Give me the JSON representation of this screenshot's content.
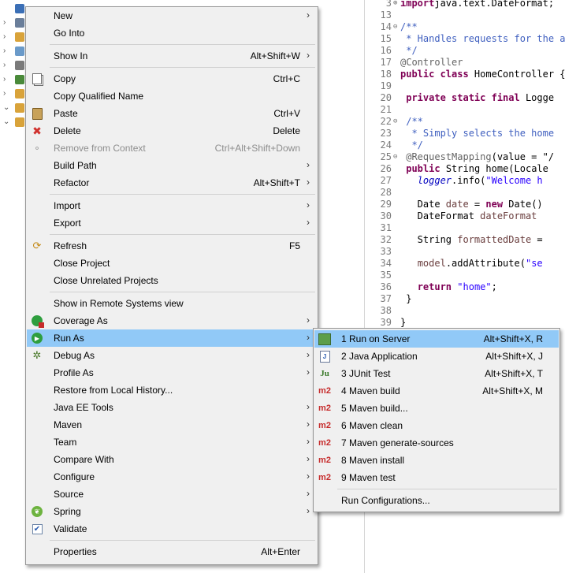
{
  "explorer": {
    "rows": [
      {
        "twisty": "",
        "color": "#3b6fb6"
      },
      {
        "twisty": "›",
        "color": "#6a7e9a"
      },
      {
        "twisty": "›",
        "color": "#d9a33a"
      },
      {
        "twisty": "›",
        "color": "#6a9ac9"
      },
      {
        "twisty": "›",
        "color": "#7a7a7a"
      },
      {
        "twisty": "›",
        "color": "#4a8a3a"
      },
      {
        "twisty": "›",
        "color": "#d9a33a"
      },
      {
        "twisty": "⌄",
        "color": "#d9a33a"
      },
      {
        "twisty": "⌄",
        "color": "#d9a33a"
      }
    ]
  },
  "editor": {
    "lines": [
      {
        "n": "3",
        "fold": "⊕",
        "html_key": "l3"
      },
      {
        "n": "13",
        "fold": "",
        "html_key": "l13"
      },
      {
        "n": "14",
        "fold": "⊖",
        "html_key": "l14"
      },
      {
        "n": "15",
        "fold": "",
        "html_key": "l15"
      },
      {
        "n": "16",
        "fold": "",
        "html_key": "l16"
      },
      {
        "n": "17",
        "fold": "",
        "html_key": "l17"
      },
      {
        "n": "18",
        "fold": "",
        "html_key": "l18"
      },
      {
        "n": "19",
        "fold": "",
        "html_key": "l19"
      },
      {
        "n": "20",
        "fold": "",
        "html_key": "l20"
      },
      {
        "n": "21",
        "fold": "",
        "html_key": "l21"
      },
      {
        "n": "22",
        "fold": "⊖",
        "html_key": "l22"
      },
      {
        "n": "23",
        "fold": "",
        "html_key": "l23"
      },
      {
        "n": "24",
        "fold": "",
        "html_key": "l24"
      },
      {
        "n": "25",
        "fold": "⊖",
        "html_key": "l25"
      },
      {
        "n": "26",
        "fold": "",
        "html_key": "l26"
      },
      {
        "n": "27",
        "fold": "",
        "html_key": "l27"
      },
      {
        "n": "28",
        "fold": "",
        "html_key": "l28"
      },
      {
        "n": "29",
        "fold": "",
        "html_key": "l29"
      },
      {
        "n": "30",
        "fold": "",
        "html_key": "l30"
      },
      {
        "n": "31",
        "fold": "",
        "html_key": "l31"
      },
      {
        "n": "32",
        "fold": "",
        "html_key": "l32"
      },
      {
        "n": "33",
        "fold": "",
        "html_key": "l33"
      },
      {
        "n": "34",
        "fold": "",
        "html_key": "l34"
      },
      {
        "n": "35",
        "fold": "",
        "html_key": "l35"
      },
      {
        "n": "36",
        "fold": "",
        "html_key": "l36"
      },
      {
        "n": "37",
        "fold": "",
        "html_key": "l37"
      },
      {
        "n": "38",
        "fold": "",
        "html_key": "l38"
      },
      {
        "n": "39",
        "fold": "",
        "html_key": "l39"
      }
    ],
    "tokens": {
      "l3": [
        [
          "kw",
          "import"
        ],
        [
          "",
          "java.text.DateFormat;"
        ]
      ],
      "l13": [],
      "l14": [
        [
          "cm",
          "/**"
        ]
      ],
      "l15": [
        [
          "cm",
          " * Handles requests for the ap"
        ]
      ],
      "l16": [
        [
          "cm",
          " */"
        ]
      ],
      "l17": [
        [
          "an",
          "@Controller"
        ]
      ],
      "l18": [
        [
          "kw",
          "public class"
        ],
        [
          "",
          " HomeController {"
        ]
      ],
      "l19": [],
      "l20": [
        [
          "",
          " "
        ],
        [
          "kw",
          "private static final"
        ],
        [
          "",
          " Logge"
        ]
      ],
      "l21": [],
      "l22": [
        [
          "",
          " "
        ],
        [
          "cm",
          "/**"
        ]
      ],
      "l23": [
        [
          "cm",
          "  * Simply selects the home"
        ]
      ],
      "l24": [
        [
          "cm",
          "  */"
        ]
      ],
      "l25": [
        [
          "",
          " "
        ],
        [
          "an",
          "@RequestMapping"
        ],
        [
          "",
          "(value = \"/"
        ]
      ],
      "l26": [
        [
          "",
          " "
        ],
        [
          "kw",
          "public"
        ],
        [
          "",
          " String home(Locale"
        ]
      ],
      "l27": [
        [
          "",
          "   "
        ],
        [
          "it",
          "logger"
        ],
        [
          "",
          ".info("
        ],
        [
          "st",
          "\"Welcome h"
        ]
      ],
      "l28": [],
      "l29": [
        [
          "",
          "   Date "
        ],
        [
          "lv",
          "date"
        ],
        [
          "",
          " = "
        ],
        [
          "kw",
          "new"
        ],
        [
          "",
          " Date()"
        ]
      ],
      "l30": [
        [
          "",
          "   DateFormat "
        ],
        [
          "lv",
          "dateFormat"
        ]
      ],
      "l31": [],
      "l32": [
        [
          "",
          "   String "
        ],
        [
          "lv",
          "formattedDate"
        ],
        [
          "",
          " ="
        ]
      ],
      "l33": [],
      "l34": [
        [
          "",
          "   "
        ],
        [
          "lv",
          "model"
        ],
        [
          "",
          ".addAttribute("
        ],
        [
          "st",
          "\"se"
        ]
      ],
      "l35": [],
      "l36": [
        [
          "",
          "   "
        ],
        [
          "kw",
          "return"
        ],
        [
          "",
          " "
        ],
        [
          "st",
          "\"home\""
        ],
        [
          "",
          ";"
        ]
      ],
      "l37": [
        [
          "",
          " }"
        ]
      ],
      "l38": [],
      "l39": [
        [
          "",
          "}"
        ]
      ]
    }
  },
  "main_menu": {
    "items": [
      {
        "label": "New",
        "shortcut": "",
        "submenu": true,
        "icon": "",
        "disabled": false
      },
      {
        "label": "Go Into",
        "shortcut": "",
        "submenu": false,
        "icon": "",
        "disabled": false
      },
      {
        "sep": true
      },
      {
        "label": "Show In",
        "shortcut": "Alt+Shift+W",
        "submenu": true,
        "icon": "",
        "disabled": false
      },
      {
        "sep": true
      },
      {
        "label": "Copy",
        "shortcut": "Ctrl+C",
        "submenu": false,
        "icon": "copy-icon",
        "disabled": false
      },
      {
        "label": "Copy Qualified Name",
        "shortcut": "",
        "submenu": false,
        "icon": "",
        "disabled": false
      },
      {
        "label": "Paste",
        "shortcut": "Ctrl+V",
        "submenu": false,
        "icon": "paste-icon",
        "disabled": false
      },
      {
        "label": "Delete",
        "shortcut": "Delete",
        "submenu": false,
        "icon": "delete-icon",
        "disabled": false
      },
      {
        "label": "Remove from Context",
        "shortcut": "Ctrl+Alt+Shift+Down",
        "submenu": false,
        "icon": "remove-context-icon",
        "disabled": true
      },
      {
        "label": "Build Path",
        "shortcut": "",
        "submenu": true,
        "icon": "",
        "disabled": false
      },
      {
        "label": "Refactor",
        "shortcut": "Alt+Shift+T",
        "submenu": true,
        "icon": "",
        "disabled": false
      },
      {
        "sep": true
      },
      {
        "label": "Import",
        "shortcut": "",
        "submenu": true,
        "icon": "",
        "disabled": false
      },
      {
        "label": "Export",
        "shortcut": "",
        "submenu": true,
        "icon": "",
        "disabled": false
      },
      {
        "sep": true
      },
      {
        "label": "Refresh",
        "shortcut": "F5",
        "submenu": false,
        "icon": "refresh-icon",
        "disabled": false
      },
      {
        "label": "Close Project",
        "shortcut": "",
        "submenu": false,
        "icon": "",
        "disabled": false
      },
      {
        "label": "Close Unrelated Projects",
        "shortcut": "",
        "submenu": false,
        "icon": "",
        "disabled": false
      },
      {
        "sep": true
      },
      {
        "label": "Show in Remote Systems view",
        "shortcut": "",
        "submenu": false,
        "icon": "",
        "disabled": false
      },
      {
        "label": "Coverage As",
        "shortcut": "",
        "submenu": true,
        "icon": "coverage-icon",
        "disabled": false
      },
      {
        "label": "Run As",
        "shortcut": "",
        "submenu": true,
        "icon": "run-icon",
        "disabled": false,
        "highlight": true
      },
      {
        "label": "Debug As",
        "shortcut": "",
        "submenu": true,
        "icon": "debug-icon",
        "disabled": false
      },
      {
        "label": "Profile As",
        "shortcut": "",
        "submenu": true,
        "icon": "",
        "disabled": false
      },
      {
        "label": "Restore from Local History...",
        "shortcut": "",
        "submenu": false,
        "icon": "",
        "disabled": false
      },
      {
        "label": "Java EE Tools",
        "shortcut": "",
        "submenu": true,
        "icon": "",
        "disabled": false
      },
      {
        "label": "Maven",
        "shortcut": "",
        "submenu": true,
        "icon": "",
        "disabled": false
      },
      {
        "label": "Team",
        "shortcut": "",
        "submenu": true,
        "icon": "",
        "disabled": false
      },
      {
        "label": "Compare With",
        "shortcut": "",
        "submenu": true,
        "icon": "",
        "disabled": false
      },
      {
        "label": "Configure",
        "shortcut": "",
        "submenu": true,
        "icon": "",
        "disabled": false
      },
      {
        "label": "Source",
        "shortcut": "",
        "submenu": true,
        "icon": "",
        "disabled": false
      },
      {
        "label": "Spring",
        "shortcut": "",
        "submenu": true,
        "icon": "spring-icon",
        "disabled": false
      },
      {
        "label": "Validate",
        "shortcut": "",
        "submenu": false,
        "icon": "check-icon",
        "disabled": false
      },
      {
        "sep": true
      },
      {
        "label": "Properties",
        "shortcut": "Alt+Enter",
        "submenu": false,
        "icon": "",
        "disabled": false
      }
    ]
  },
  "run_as_menu": {
    "items": [
      {
        "label": "1 Run on Server",
        "shortcut": "Alt+Shift+X, R",
        "icon": "server-icon",
        "highlight": true
      },
      {
        "label": "2 Java Application",
        "shortcut": "Alt+Shift+X, J",
        "icon": "java-app-icon"
      },
      {
        "label": "3 JUnit Test",
        "shortcut": "Alt+Shift+X, T",
        "icon": "junit-icon"
      },
      {
        "label": "4 Maven build",
        "shortcut": "Alt+Shift+X, M",
        "icon": "maven-icon"
      },
      {
        "label": "5 Maven build...",
        "shortcut": "",
        "icon": "maven-icon"
      },
      {
        "label": "6 Maven clean",
        "shortcut": "",
        "icon": "maven-icon"
      },
      {
        "label": "7 Maven generate-sources",
        "shortcut": "",
        "icon": "maven-icon"
      },
      {
        "label": "8 Maven install",
        "shortcut": "",
        "icon": "maven-icon"
      },
      {
        "label": "9 Maven test",
        "shortcut": "",
        "icon": "maven-icon"
      },
      {
        "sep": true
      },
      {
        "label": "Run Configurations...",
        "shortcut": "",
        "icon": ""
      }
    ]
  }
}
